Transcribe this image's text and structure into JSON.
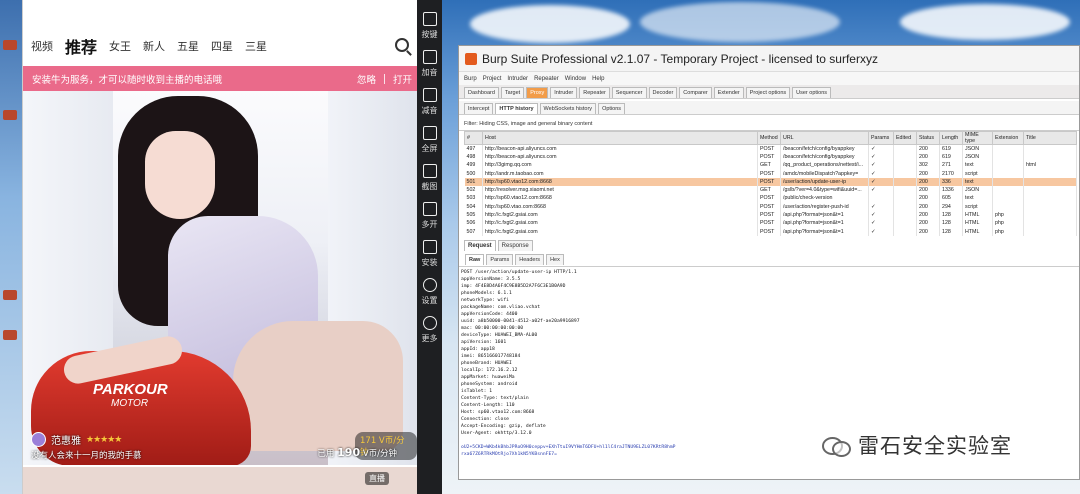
{
  "phone": {
    "tabs": [
      "视频",
      "推荐",
      "女王",
      "新人",
      "五星",
      "四星",
      "三星"
    ],
    "banner": {
      "text": "安装牛为服务，才可以随时收到主播的电话哦",
      "ignore": "忽略",
      "open": "打开"
    },
    "photo_text": {
      "brand": "PARKOUR",
      "sub": "MOTOR"
    },
    "streamer": {
      "name": "范惠雅",
      "stars": "★★★★★",
      "price": "171 V币/分钟",
      "desc": "没有人会来十一月的我的手慕",
      "rate_prefix": "已用",
      "rate_value": "190",
      "rate_unit": "V币/分钟"
    },
    "next_tag": "直播"
  },
  "emulator_sidebar": [
    "按键",
    "加音",
    "减音",
    "全屏",
    "截图",
    "多开",
    "安装",
    "设置",
    "更多"
  ],
  "burp": {
    "title": "Burp Suite Professional v2.1.07 - Temporary Project - licensed to surferxyz",
    "menu": [
      "Burp",
      "Project",
      "Intruder",
      "Repeater",
      "Window",
      "Help"
    ],
    "tabs": [
      "Dashboard",
      "Target",
      "Proxy",
      "Intruder",
      "Repeater",
      "Sequencer",
      "Decoder",
      "Comparer",
      "Extender",
      "Project options",
      "User options"
    ],
    "active_tab": "Proxy",
    "subtabs": [
      "Intercept",
      "HTTP history",
      "WebSockets history",
      "Options"
    ],
    "selected_subtab": "HTTP history",
    "filter": "Filter: Hiding CSS, image and general binary content",
    "columns": [
      "#",
      "Host",
      "Method",
      "URL",
      "Params",
      "Edited",
      "Status",
      "Length",
      "MIME type",
      "Extension",
      "Title"
    ],
    "rows": [
      [
        "497",
        "http://beacon-api.aliyuncs.com",
        "POST",
        "/beacon/fetch/config/byappkey",
        "✓",
        "",
        "200",
        "619",
        "JSON",
        "",
        ""
      ],
      [
        "498",
        "http://beacon-api.aliyuncs.com",
        "POST",
        "/beacon/fetch/config/byappkey",
        "✓",
        "",
        "200",
        "619",
        "JSON",
        "",
        ""
      ],
      [
        "499",
        "http://3gimg.qq.com",
        "GET",
        "/qq_product_operations/nettest/i...",
        "✓",
        "",
        "302",
        "271",
        "text",
        "",
        "html"
      ],
      [
        "500",
        "http://andr.m.taobao.com",
        "POST",
        "/amdc/mobileDispatch?appkey=",
        "✓",
        "",
        "200",
        "2170",
        "script",
        "",
        ""
      ],
      [
        "501",
        "http://sp60.vtao12.com:8668",
        "POST",
        "/user/action/update-user-ip",
        "✓",
        "",
        "200",
        "336",
        "text",
        "",
        ""
      ],
      [
        "502",
        "http://resolver.msg.xiaomi.net",
        "GET",
        "/gslb/?ver=4.0&type=wifi&uuid=...",
        "✓",
        "",
        "200",
        "1336",
        "JSON",
        "",
        ""
      ],
      [
        "503",
        "http://sp60.vtao12.com:8668",
        "POST",
        "/public/check-version",
        "",
        "",
        "200",
        "605",
        "text",
        "",
        ""
      ],
      [
        "504",
        "http://sp60.vtao.com:8668",
        "POST",
        "/user/action/register-push-id",
        "✓",
        "",
        "200",
        "294",
        "script",
        "",
        ""
      ],
      [
        "505",
        "http://c.fxgt2.gsiai.com",
        "POST",
        "/api.php?format=json&t=1",
        "✓",
        "",
        "200",
        "128",
        "HTML",
        "php",
        ""
      ],
      [
        "506",
        "http://c.fxgt2.gsiai.com",
        "POST",
        "/api.php?format=json&t=1",
        "✓",
        "",
        "200",
        "128",
        "HTML",
        "php",
        ""
      ],
      [
        "507",
        "http://c.fxgt2.gsiai.com",
        "POST",
        "/api.php?format=json&t=1",
        "✓",
        "",
        "200",
        "128",
        "HTML",
        "php",
        ""
      ]
    ],
    "highlight_row": "501",
    "req_tabs": [
      "Request",
      "Response"
    ],
    "raw_tabs": [
      "Raw",
      "Params",
      "Headers",
      "Hex"
    ],
    "request_lines": [
      "POST /user/action/update-user-ip HTTP/1.1",
      "appVersionName: 3.5.5",
      "imp: 4F4E8D4A6F4C9E8B5D2A7F6C3E1B0A9D",
      "phoneModels: 6.1.1",
      "networkType: wifi",
      "packageName: com.vliao.vchat",
      "appVersionCode: 4400",
      "uuid: a8b50000-0041-4512-a02f-ae20a9916897",
      "mac: 00:00:00:00:00:00",
      "deviceType: HUAWEI_BMA-AL00",
      "apiVersion: 1601",
      "appId: app18",
      "imei: 865166017748184",
      "phoneBrand: HUAWEI",
      "localIp: 172.16.2.12",
      "appMarket: huaweiMa",
      "phoneSystem: android",
      "isTablet: 1",
      "Content-Type: text/plain",
      "Content-Length: 110",
      "Host: sp60.vtao12.com:8668",
      "Connection: close",
      "Accept-Encoding: gzip, deflate",
      "User-Agent: okhttp/3.12.0"
    ],
    "request_body": [
      "oU2+5CKD+WKb4kBhbJPRoO9H0ceppv+EXhTtuI9VYHmT6DFU+hl1lC4raJTNU9ELZL07KRtR8hmP",
      "rxa67Z6RTRkMOtRjo7Xh1kN5YKBsnnFE7="
    ]
  },
  "watermark": "雷石安全实验室"
}
